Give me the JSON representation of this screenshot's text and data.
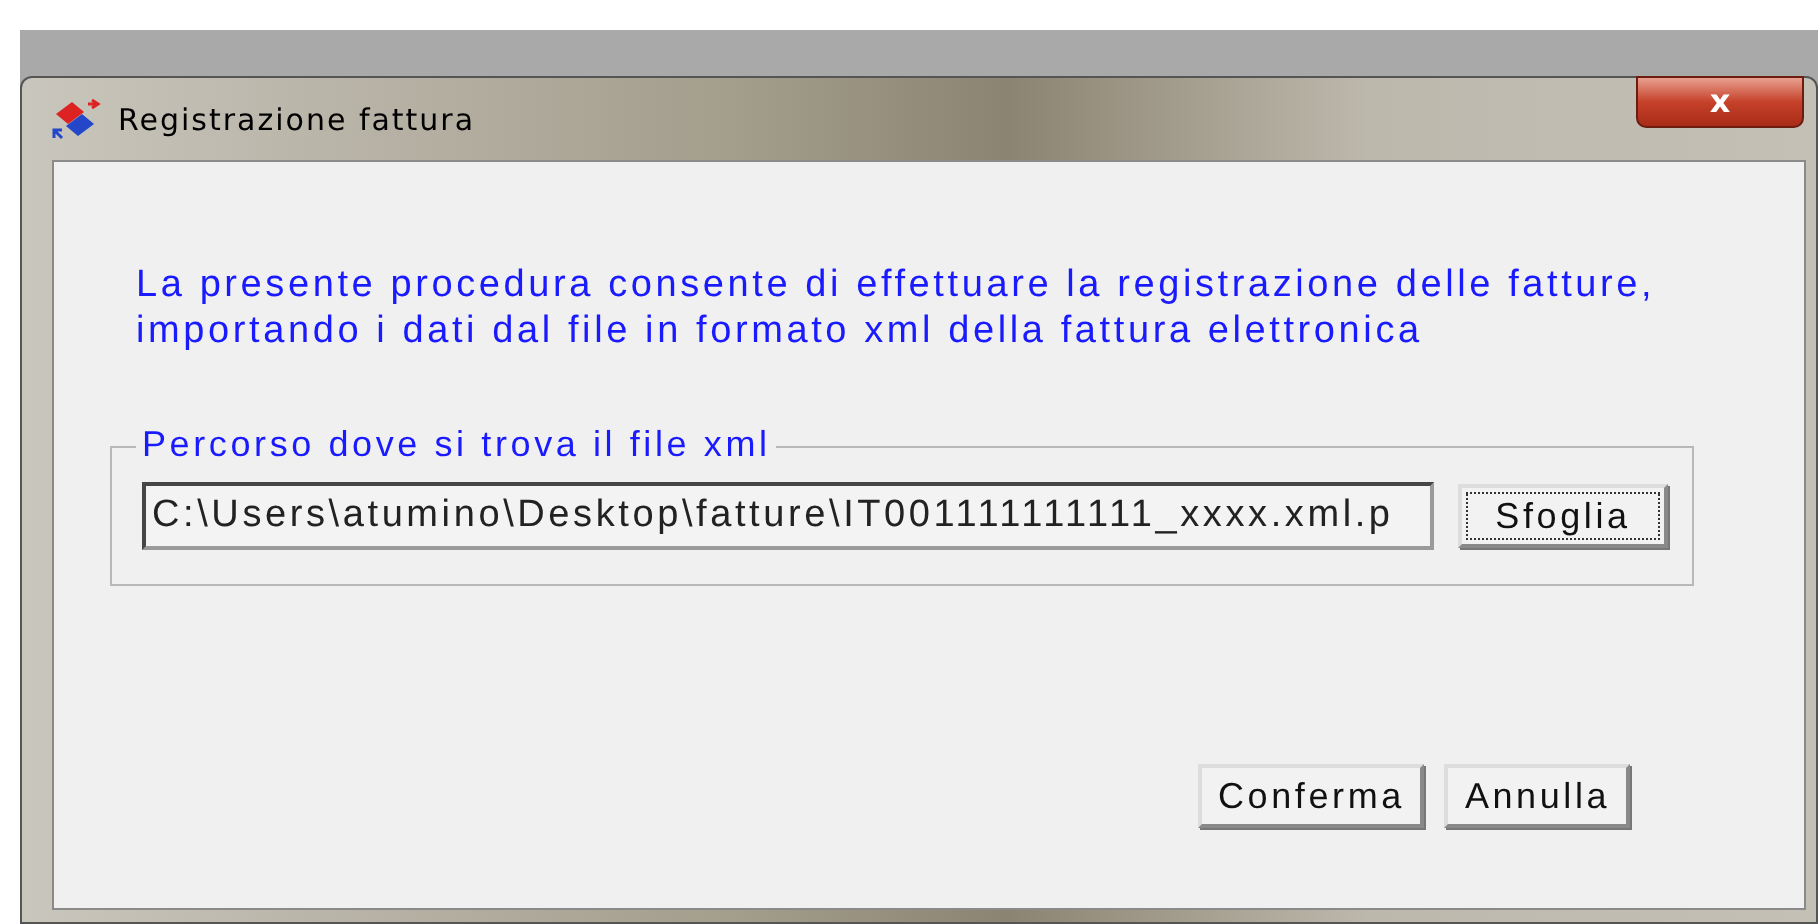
{
  "window": {
    "title": "Registrazione fattura",
    "close": "x"
  },
  "description": "La presente procedura consente di effettuare la registrazione delle fatture, importando i dati dal file in formato xml della fattura elettronica",
  "group": {
    "legend": "Percorso dove si trova il file xml",
    "path": "C:\\Users\\atumino\\Desktop\\fatture\\IT001111111111_xxxx.xml.p",
    "browse": "Sfoglia"
  },
  "buttons": [
    "Conferma",
    "Annulla"
  ]
}
